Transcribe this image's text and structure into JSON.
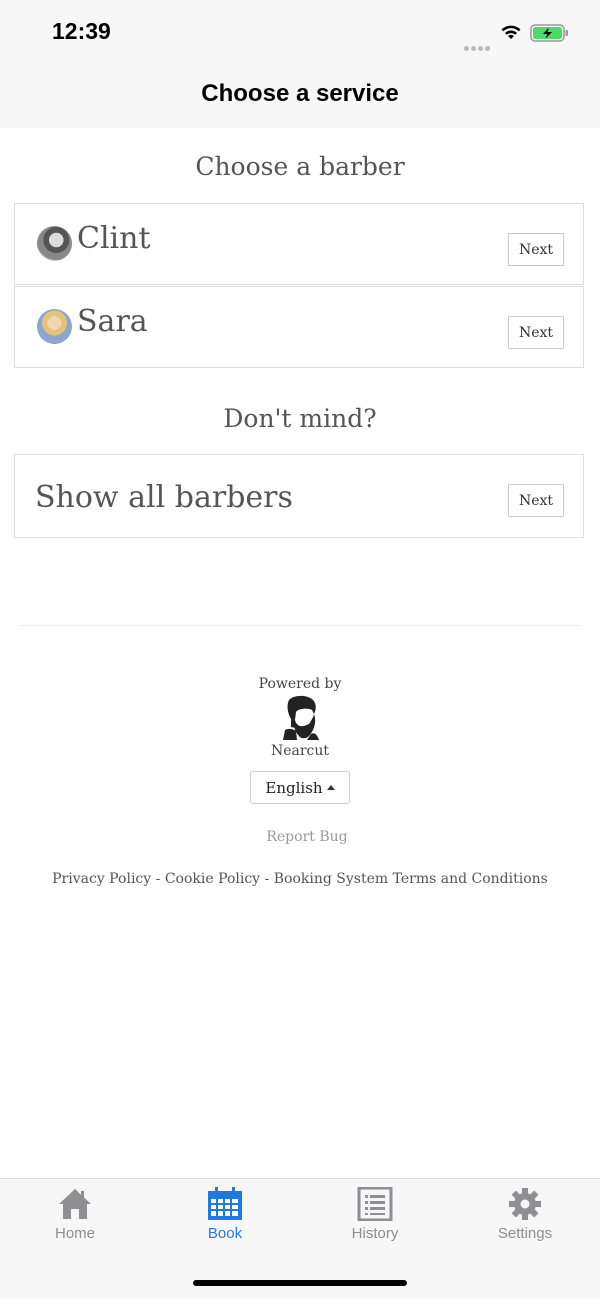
{
  "status_bar": {
    "time": "12:39"
  },
  "header": {
    "title": "Choose a service"
  },
  "barber_section": {
    "title": "Choose a barber"
  },
  "barbers": [
    {
      "name": "Clint",
      "next_label": "Next"
    },
    {
      "name": "Sara",
      "next_label": "Next"
    }
  ],
  "alternative_section": {
    "title": "Don't mind?",
    "show_all_label": "Show all barbers",
    "next_label": "Next"
  },
  "footer": {
    "powered_by": "Powered by",
    "brand": "Nearcut",
    "language": "English",
    "report_bug": "Report Bug",
    "privacy_policy": "Privacy Policy",
    "separator": " - ",
    "cookie_policy": "Cookie Policy",
    "terms": "Booking System Terms and Conditions"
  },
  "tabs": [
    {
      "label": "Home",
      "icon": "home-icon"
    },
    {
      "label": "Book",
      "icon": "calendar-icon",
      "active": true
    },
    {
      "label": "History",
      "icon": "list-icon"
    },
    {
      "label": "Settings",
      "icon": "gear-icon"
    }
  ],
  "colors": {
    "accent": "#1f7ae0",
    "tab_inactive": "#8e8e93",
    "battery_green": "#4cd964"
  }
}
